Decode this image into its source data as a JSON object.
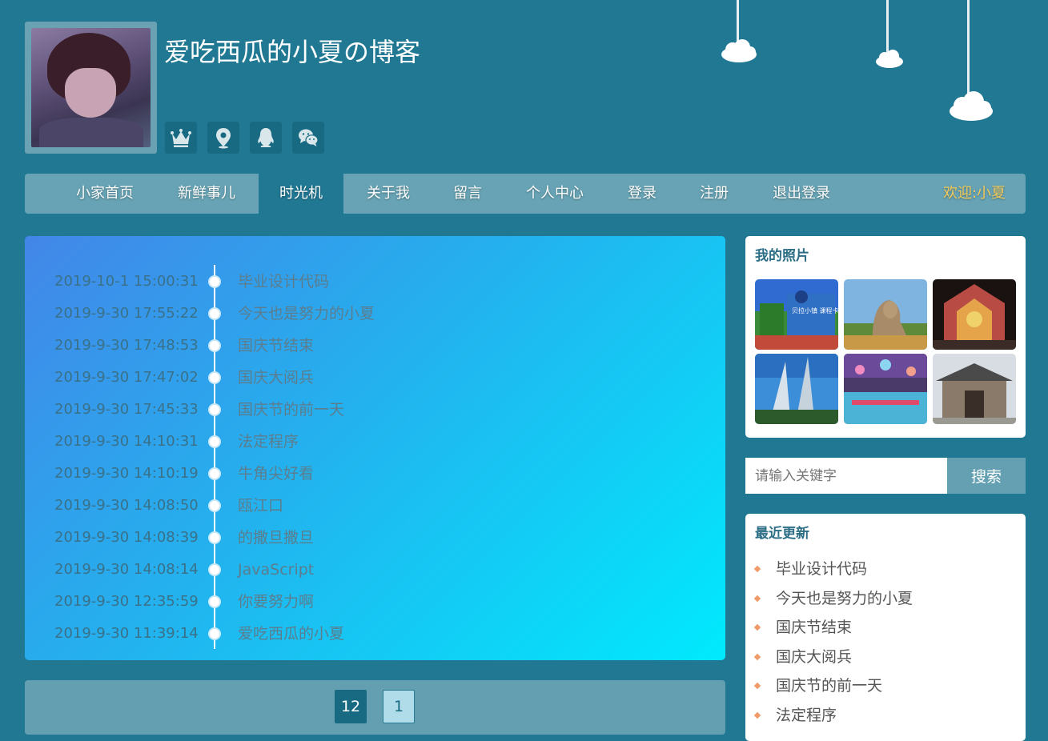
{
  "blog": {
    "title": "爱吃西瓜的小夏の博客"
  },
  "social": [
    {
      "icon": "crown-icon"
    },
    {
      "icon": "location-pin-icon"
    },
    {
      "icon": "qq-icon"
    },
    {
      "icon": "wechat-icon"
    }
  ],
  "nav": {
    "items": [
      "小家首页",
      "新鲜事儿",
      "时光机",
      "关于我",
      "留言",
      "个人中心",
      "登录",
      "注册",
      "退出登录"
    ],
    "active": "时光机",
    "welcome": "欢迎:小夏"
  },
  "timeline": [
    {
      "date": "2019-10-1 15:00:31",
      "title": "毕业设计代码"
    },
    {
      "date": "2019-9-30 17:55:22",
      "title": "今天也是努力的小夏"
    },
    {
      "date": "2019-9-30 17:48:53",
      "title": "国庆节结束"
    },
    {
      "date": "2019-9-30 17:47:02",
      "title": "国庆大阅兵"
    },
    {
      "date": "2019-9-30 17:45:33",
      "title": "国庆节的前一天"
    },
    {
      "date": "2019-9-30 14:10:31",
      "title": "法定程序"
    },
    {
      "date": "2019-9-30 14:10:19",
      "title": "牛角尖好看"
    },
    {
      "date": "2019-9-30 14:08:50",
      "title": "瓯江口"
    },
    {
      "date": "2019-9-30 14:08:39",
      "title": "的撒旦撒旦"
    },
    {
      "date": "2019-9-30 14:08:14",
      "title": "JavaScript"
    },
    {
      "date": "2019-9-30 12:35:59",
      "title": "你要努力啊"
    },
    {
      "date": "2019-9-30 11:39:14",
      "title": "爱吃西瓜的小夏"
    }
  ],
  "pagination": {
    "total_label": "12",
    "current_page": "1"
  },
  "photos": {
    "title": "我的照片",
    "banner_text": "贝拉小镇 课程卡全新上线"
  },
  "search": {
    "placeholder": "请输入关键字",
    "button": "搜索"
  },
  "recent": {
    "title": "最近更新",
    "items": [
      "毕业设计代码",
      "今天也是努力的小夏",
      "国庆节结束",
      "国庆大阅兵",
      "国庆节的前一天",
      "法定程序"
    ]
  },
  "colors": {
    "background": "#217893",
    "nav": "#67a3b4",
    "nav_active": "#217893",
    "welcome": "#f3cb5b",
    "accent_dark": "#176a82"
  }
}
